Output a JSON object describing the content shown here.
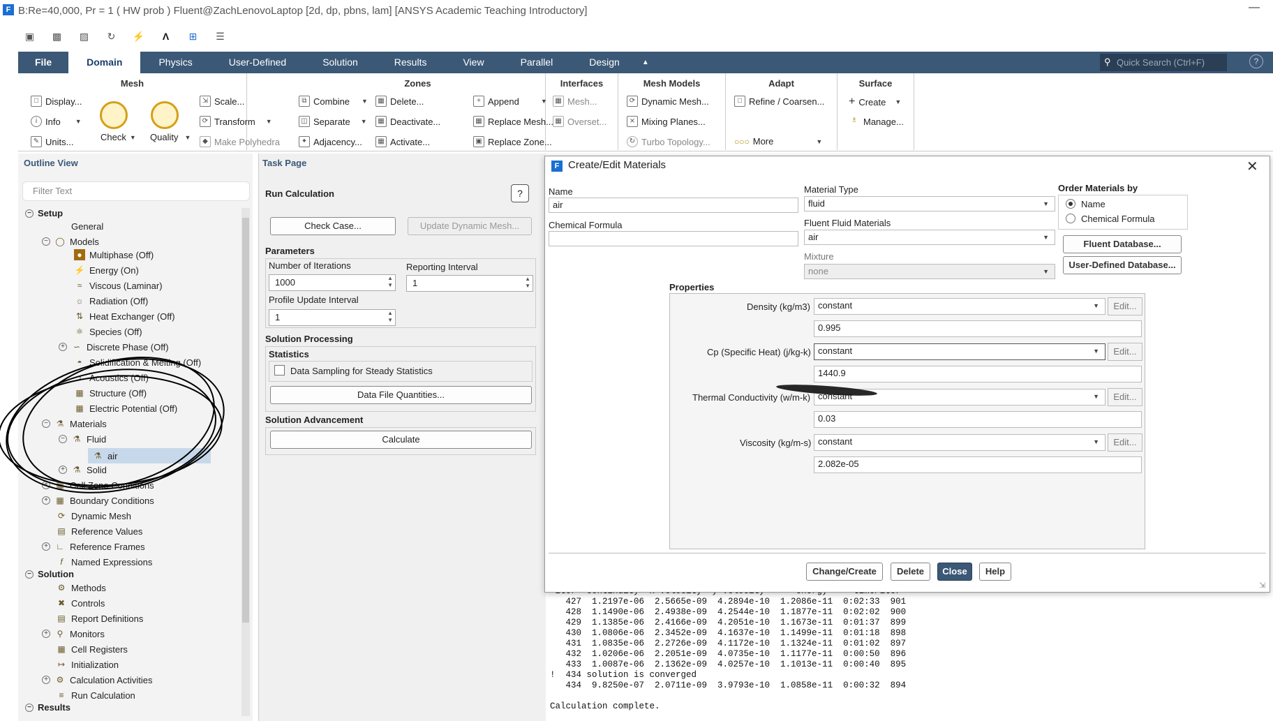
{
  "window": {
    "title": "B:Re=40,000, Pr = 1 ( HW prob ) Fluent@ZachLenovoLaptop  [2d, dp, pbns, lam] [ANSYS Academic Teaching Introductory]",
    "app_icon": "F",
    "minimize": "—"
  },
  "ribbon_tabs": [
    "File",
    "Domain",
    "Physics",
    "User-Defined",
    "Solution",
    "Results",
    "View",
    "Parallel",
    "Design"
  ],
  "quick_search": "Quick Search (Ctrl+F)",
  "help_icon": "?",
  "ribbon": {
    "mesh": {
      "title": "Mesh",
      "display": "Display...",
      "info": "Info",
      "units": "Units...",
      "check": "Check",
      "quality": "Quality",
      "scale": "Scale...",
      "transform": "Transform",
      "make_polyhedra": "Make Polyhedra"
    },
    "zones": {
      "title": "Zones",
      "combine": "Combine",
      "separate": "Separate",
      "adjacency": "Adjacency...",
      "delete": "Delete...",
      "deactivate": "Deactivate...",
      "activate": "Activate...",
      "append": "Append",
      "replace_mesh": "Replace Mesh...",
      "replace_zone": "Replace Zone..."
    },
    "interfaces": {
      "title": "Interfaces",
      "mesh": "Mesh...",
      "overset": "Overset..."
    },
    "mesh_models": {
      "title": "Mesh Models",
      "dynamic_mesh": "Dynamic Mesh...",
      "mixing_planes": "Mixing Planes...",
      "turbo_topology": "Turbo Topology..."
    },
    "adapt": {
      "title": "Adapt",
      "refine": "Refine / Coarsen...",
      "more": "More"
    },
    "surface": {
      "title": "Surface",
      "create": "Create",
      "manage": "Manage..."
    }
  },
  "outline": {
    "title": "Outline View",
    "filter_placeholder": "Filter Text",
    "setup": "Setup",
    "general": "General",
    "models": "Models",
    "model_items": [
      "Multiphase (Off)",
      "Energy (On)",
      "Viscous (Laminar)",
      "Radiation (Off)",
      "Heat Exchanger (Off)",
      "Species (Off)",
      "Discrete Phase (Off)",
      "Solidification & Melting (Off)",
      "Acoustics (Off)",
      "Structure (Off)",
      "Electric Potential (Off)"
    ],
    "materials": "Materials",
    "fluid": "Fluid",
    "air": "air",
    "solid": "Solid",
    "cell_zone": "Cell Zone Conditions",
    "boundary": "Boundary Conditions",
    "dynamic_mesh": "Dynamic Mesh",
    "reference_values": "Reference Values",
    "reference_frames": "Reference Frames",
    "named_expressions": "Named Expressions",
    "solution": "Solution",
    "solution_items": [
      "Methods",
      "Controls",
      "Report Definitions",
      "Monitors",
      "Cell Registers",
      "Initialization",
      "Calculation Activities",
      "Run Calculation"
    ],
    "results": "Results"
  },
  "task": {
    "title": "Task Page",
    "heading": "Run Calculation",
    "check_case": "Check Case...",
    "update_dynamic_mesh": "Update Dynamic Mesh...",
    "parameters": "Parameters",
    "num_iter_label": "Number of Iterations",
    "num_iter": "1000",
    "report_interval_label": "Reporting Interval",
    "report_interval": "1",
    "profile_label": "Profile Update Interval",
    "profile_interval": "1",
    "solution_processing": "Solution Processing",
    "statistics": "Statistics",
    "data_sampling": "Data Sampling for Steady Statistics",
    "data_file_quantities": "Data File Quantities...",
    "solution_advancement": "Solution Advancement",
    "calculate": "Calculate"
  },
  "dialog": {
    "title": "Create/Edit Materials",
    "name_label": "Name",
    "name": "air",
    "chem_label": "Chemical Formula",
    "chem": "",
    "material_type_label": "Material Type",
    "material_type": "fluid",
    "fluent_fluid_label": "Fluent Fluid Materials",
    "fluent_fluid": "air",
    "mixture_label": "Mixture",
    "mixture": "none",
    "order_by_label": "Order Materials by",
    "order_name": "Name",
    "order_chem": "Chemical Formula",
    "fluent_db": "Fluent Database...",
    "user_db": "User-Defined Database...",
    "properties_label": "Properties",
    "properties": [
      {
        "label": "Density (kg/m3)",
        "method": "constant",
        "value": "0.995"
      },
      {
        "label": "Cp (Specific Heat) (j/kg-k)",
        "method": "constant",
        "value": "1440.9"
      },
      {
        "label": "Thermal Conductivity (w/m-k)",
        "method": "constant",
        "value": "0.03"
      },
      {
        "label": "Viscosity (kg/m-s)",
        "method": "constant",
        "value": "2.082e-05"
      }
    ],
    "edit": "Edit...",
    "change_create": "Change/Create",
    "delete": "Delete",
    "close": "Close",
    "help": "Help"
  },
  "console": {
    "header": " iter  continuity  x-velocity  y-velocity      energy     time/iter",
    "rows": [
      "   427  1.2197e-06  2.5665e-09  4.2894e-10  1.2086e-11  0:02:33  901",
      "   428  1.1490e-06  2.4938e-09  4.2544e-10  1.1877e-11  0:02:02  900",
      "   429  1.1385e-06  2.4166e-09  4.2051e-10  1.1673e-11  0:01:37  899",
      "   430  1.0806e-06  2.3452e-09  4.1637e-10  1.1499e-11  0:01:18  898",
      "   431  1.0835e-06  2.2726e-09  4.1172e-10  1.1324e-11  0:01:02  897",
      "   432  1.0206e-06  2.2051e-09  4.0735e-10  1.1177e-11  0:00:50  896",
      "   433  1.0087e-06  2.1362e-09  4.0257e-10  1.1013e-11  0:00:40  895",
      "!  434 solution is converged",
      "   434  9.8250e-07  2.0711e-09  3.9793e-10  1.0858e-11  0:00:32  894",
      "",
      "Calculation complete."
    ]
  }
}
